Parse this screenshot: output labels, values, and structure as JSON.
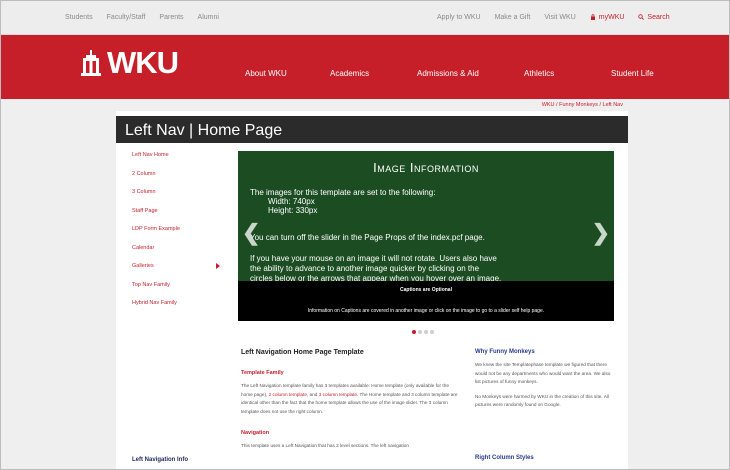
{
  "utility_nav": {
    "left": [
      "Students",
      "Faculty/Staff",
      "Parents",
      "Alumni"
    ],
    "right": [
      "Apply to WKU",
      "Make a Gift",
      "Visit WKU"
    ],
    "mywku": "myWKU",
    "search": "Search"
  },
  "brand": {
    "logo_text": "WKU",
    "red": "#c61f2a"
  },
  "main_nav": [
    "About WKU",
    "Academics",
    "Admissions & Aid",
    "Athletics",
    "Student Life"
  ],
  "breadcrumb": "WKU / Funny Monkeys / Left Nav",
  "page_title": "Left Nav | Home Page",
  "left_nav": {
    "items": [
      "Left Nav Home",
      "2 Column",
      "3 Column",
      "Staff Page",
      "LDP Form Example",
      "Calendar",
      "Galleries",
      "Top Nav Family",
      "Hybrid Nav Family"
    ],
    "info_heading": "Left Navigation Info"
  },
  "slider": {
    "title": "Image Information",
    "lines": [
      "The images for this template are set to the following:",
      "Width: 740px",
      "Height: 330px",
      "You can turn off the slider in the Page Props of the index.pcf page.",
      "If you have your mouse on an image it will not rotate. Users also have",
      "the ability to advance to another image quicker by clicking on the",
      "circles below or the arrows that appear when you hover over an image."
    ],
    "caption_title": "Captions are Optional",
    "caption_text": "Information on Captions are covered in another image or click on the image to go to a slider self help page.",
    "prev": "❮",
    "next": "❯",
    "dots": 4,
    "active_dot": 1
  },
  "main": {
    "heading": "Left Navigation Home Page Template",
    "family_heading": "Template Family",
    "family_text_1": "The Left Navigation template family has 3 templates available: Home template (only available for the home page),",
    "family_link_1": "2 column template",
    "family_text_2": ", and",
    "family_link_2": "3 column template",
    "family_text_3": ". The Home template and 3 column template are identical other than the fact that the home template allows the use of the image slider. The 3 column template does not use the right column.",
    "nav_heading": "Navigation",
    "nav_text": "This template uses a Left Navigation that has 2 level sections. The left navigation"
  },
  "right_col": {
    "heading": "Why Funny Monkeys",
    "text_1": "We knew the site Templatephase template we figured that there would not be any departments who would want the area. We also list pictures of funny monkeys.",
    "text_2": "No Monkeys were harmed by WKU in the creation of this site. All pictures were randomly found on Google.",
    "heading_2": "Right Column Styles"
  }
}
